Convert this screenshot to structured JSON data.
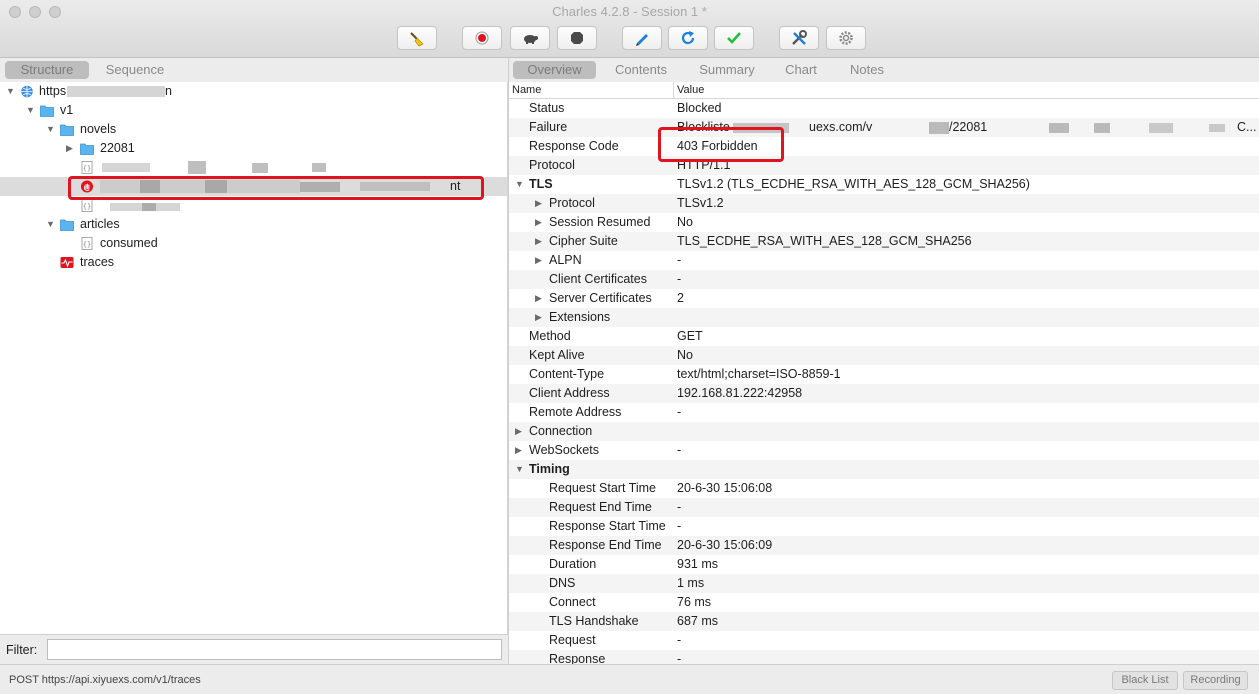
{
  "window": {
    "title": "Charles 4.2.8 - Session 1 *"
  },
  "left_tabs": [
    "Structure",
    "Sequence"
  ],
  "right_tabs": [
    "Overview",
    "Contents",
    "Summary",
    "Chart",
    "Notes"
  ],
  "tree": {
    "root": "https",
    "root_suffix": "n",
    "v1": "v1",
    "novels": "novels",
    "folder_22081": "22081",
    "selected_suffix": "nt",
    "articles": "articles",
    "consumed": "consumed",
    "traces": "traces"
  },
  "table": {
    "col_name": "Name",
    "col_value": "Value",
    "rows": [
      {
        "name": "Status",
        "value": "Blocked"
      },
      {
        "name": "Failure",
        "value": "Blockliste",
        "value_tail": "uexs.com/v",
        "value_tail2": "/22081",
        "value_end": "C..."
      },
      {
        "name": "Response Code",
        "value": "403 Forbidden"
      },
      {
        "name": "Protocol",
        "value": "HTTP/1.1"
      },
      {
        "name": "TLS",
        "value": "TLSv1.2 (TLS_ECDHE_RSA_WITH_AES_128_GCM_SHA256)"
      },
      {
        "name": "Protocol",
        "value": "TLSv1.2"
      },
      {
        "name": "Session Resumed",
        "value": "No"
      },
      {
        "name": "Cipher Suite",
        "value": "TLS_ECDHE_RSA_WITH_AES_128_GCM_SHA256"
      },
      {
        "name": "ALPN",
        "value": "-"
      },
      {
        "name": "Client Certificates",
        "value": "-"
      },
      {
        "name": "Server Certificates",
        "value": "2"
      },
      {
        "name": "Extensions",
        "value": ""
      },
      {
        "name": "Method",
        "value": "GET"
      },
      {
        "name": "Kept Alive",
        "value": "No"
      },
      {
        "name": "Content-Type",
        "value": "text/html;charset=ISO-8859-1"
      },
      {
        "name": "Client Address",
        "value": "192.168.81.222:42958"
      },
      {
        "name": "Remote Address",
        "value": "-"
      },
      {
        "name": "Connection",
        "value": ""
      },
      {
        "name": "WebSockets",
        "value": "-"
      },
      {
        "name": "Timing",
        "value": ""
      },
      {
        "name": "Request Start Time",
        "value": "20-6-30 15:06:08"
      },
      {
        "name": "Request End Time",
        "value": "-"
      },
      {
        "name": "Response Start Time",
        "value": "-"
      },
      {
        "name": "Response End Time",
        "value": "20-6-30 15:06:09"
      },
      {
        "name": "Duration",
        "value": "931 ms"
      },
      {
        "name": "DNS",
        "value": "1 ms"
      },
      {
        "name": "Connect",
        "value": "76 ms"
      },
      {
        "name": "TLS Handshake",
        "value": "687 ms"
      },
      {
        "name": "Request",
        "value": "-"
      },
      {
        "name": "Response",
        "value": "-"
      }
    ]
  },
  "filter": {
    "label": "Filter:",
    "value": ""
  },
  "status": {
    "text": "POST https://api.xiyuexs.com/v1/traces",
    "black_list": "Black List",
    "recording": "Recording"
  },
  "colors": {
    "highlight": "#e0141e",
    "folder": "#5ab4f0",
    "blocked": "#e0141e"
  },
  "toolbar_icons": [
    "broom-icon",
    "record-icon",
    "throttle-icon",
    "breakpoint-icon",
    "compose-icon",
    "repeat-icon",
    "validate-icon",
    "tools-icon",
    "settings-icon"
  ]
}
